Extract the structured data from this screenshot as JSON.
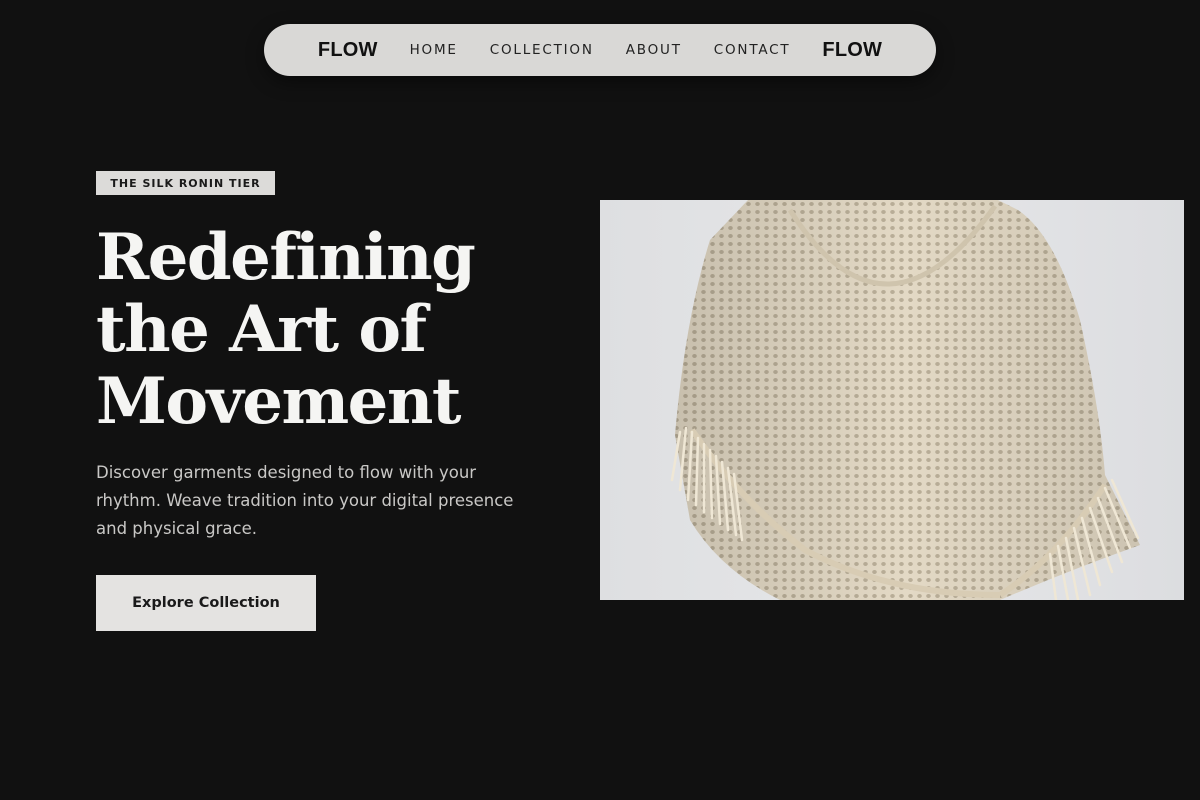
{
  "nav": {
    "logo_left": "FLOW",
    "logo_right": "FLOW",
    "links": [
      {
        "label": "HOME"
      },
      {
        "label": "COLLECTION"
      },
      {
        "label": "ABOUT"
      },
      {
        "label": "CONTACT"
      }
    ]
  },
  "hero": {
    "tag": "THE SILK RONIN TIER",
    "headline_lines": [
      "Redefining",
      "the Art of",
      "Movement"
    ],
    "description": "Discover garments designed to flow with your rhythm. Weave tradition into your digital presence and physical grace.",
    "cta_label": "Explore Collection",
    "image_subject": "cream crochet knit poncho top with fringe on wooden hanger"
  },
  "colors": {
    "background": "#111111",
    "nav_bg": "#d9d8d6",
    "headline": "#f5f5f3",
    "body_text": "#c9c8c6",
    "button_bg": "#e4e3e1",
    "garment": "#e2d8c3"
  }
}
